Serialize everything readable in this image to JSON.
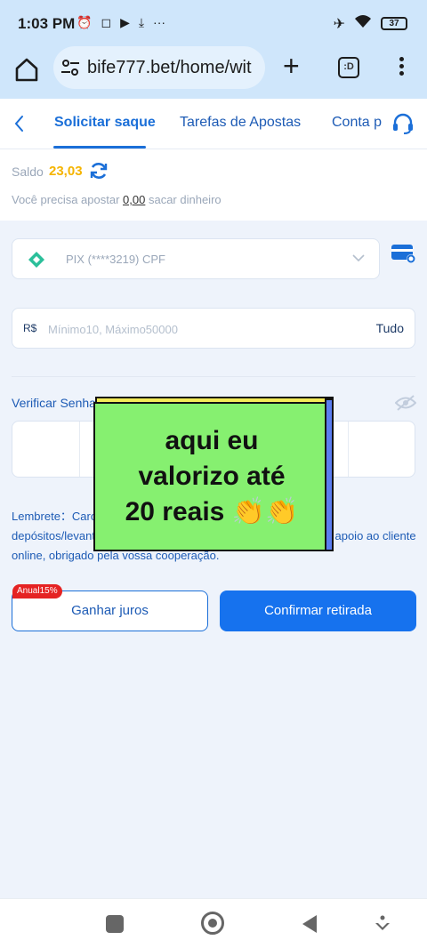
{
  "status_bar": {
    "time": "1:03 PM",
    "battery": "37"
  },
  "browser": {
    "url": "bife777.bet/home/wit",
    "tabs_label": ":D"
  },
  "tabs": [
    {
      "label": "Solicitar saque",
      "active": true
    },
    {
      "label": "Tarefas de Apostas",
      "active": false
    },
    {
      "label": "Conta p",
      "active": false
    }
  ],
  "balance": {
    "label": "Saldo",
    "value": "23,03",
    "bet_prefix": "Você precisa apostar",
    "bet_amount": "0,00",
    "bet_suffix": "sacar dinheiro"
  },
  "account_select": {
    "value": "PIX (****3219)  CPF"
  },
  "amount": {
    "currency": "R$",
    "placeholder": "Mínimo10, Máximo50000",
    "all_label": "Tudo"
  },
  "verify": {
    "label": "Verificar Senha"
  },
  "reminder": {
    "text": "Lembrete：Caro usuário, se tiver algum problema com depósitos/levantamentos, podem contactar o nosso serviço de apoio ao cliente online, obrigado pela vossa cooperação."
  },
  "buttons": {
    "earn_label": "Ganhar juros",
    "earn_badge": "Anual15%",
    "confirm_label": "Confirmar retirada"
  },
  "overlay": {
    "line1": "aqui eu",
    "line2": "valorizo até",
    "line3": "20 reais 👏👏"
  },
  "colors": {
    "accent": "#1b6fd8",
    "balance": "#f5b400",
    "badge": "#e52323",
    "sticker": "#86f070"
  }
}
